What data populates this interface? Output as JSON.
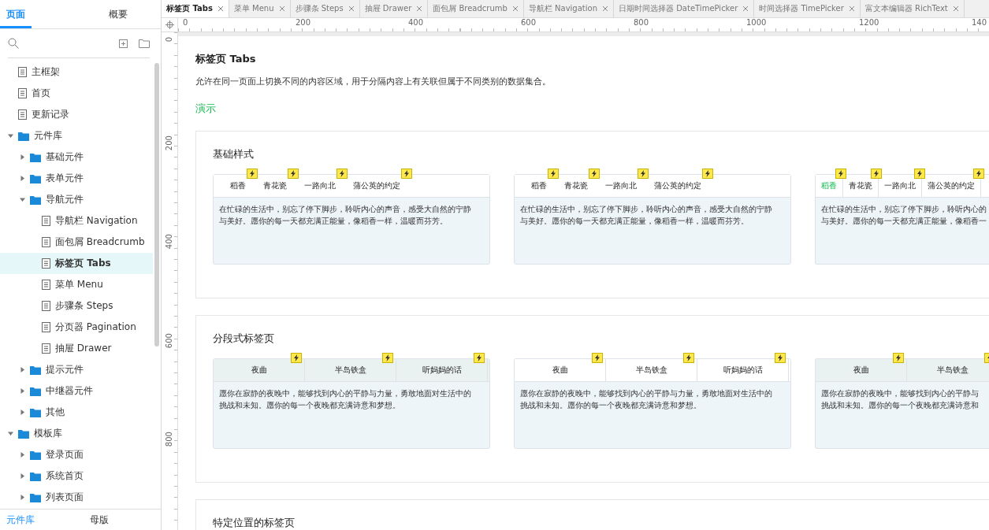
{
  "sidebar": {
    "tabs": [
      {
        "label": "页面",
        "selected": true
      },
      {
        "label": "概要",
        "selected": false
      }
    ],
    "tree": [
      {
        "label": "主框架",
        "kind": "page",
        "selected": false
      },
      {
        "label": "首页",
        "kind": "page",
        "selected": false
      },
      {
        "label": "更新记录",
        "kind": "page",
        "selected": false
      },
      {
        "label": "元件库",
        "kind": "folder",
        "expanded": true,
        "selected": false,
        "children": [
          {
            "label": "基础元件",
            "kind": "folder",
            "expanded": false,
            "selected": false
          },
          {
            "label": "表单元件",
            "kind": "folder",
            "expanded": false,
            "selected": false
          },
          {
            "label": "导航元件",
            "kind": "folder",
            "expanded": true,
            "selected": false,
            "children": [
              {
                "label": "导航栏 Navigation",
                "kind": "page",
                "selected": false
              },
              {
                "label": "面包屑 Breadcrumb",
                "kind": "page",
                "selected": false
              },
              {
                "label": "标签页 Tabs",
                "kind": "page",
                "selected": true
              },
              {
                "label": "菜单 Menu",
                "kind": "page",
                "selected": false
              },
              {
                "label": "步骤条 Steps",
                "kind": "page",
                "selected": false
              },
              {
                "label": "分页器 Pagination",
                "kind": "page",
                "selected": false
              },
              {
                "label": "抽屉 Drawer",
                "kind": "page",
                "selected": false
              }
            ]
          },
          {
            "label": "提示元件",
            "kind": "folder",
            "expanded": false,
            "selected": false
          },
          {
            "label": "中继器元件",
            "kind": "folder",
            "expanded": false,
            "selected": false
          },
          {
            "label": "其他",
            "kind": "folder",
            "expanded": false,
            "selected": false
          }
        ]
      },
      {
        "label": "模板库",
        "kind": "folder",
        "expanded": true,
        "selected": false,
        "children": [
          {
            "label": "登录页面",
            "kind": "folder",
            "expanded": false,
            "selected": false
          },
          {
            "label": "系统首页",
            "kind": "folder",
            "expanded": false,
            "selected": false
          },
          {
            "label": "列表页面",
            "kind": "folder",
            "expanded": false,
            "selected": false
          }
        ]
      }
    ],
    "bottom_tabs": [
      {
        "label": "元件库",
        "selected": true
      },
      {
        "label": "母版",
        "selected": false
      }
    ]
  },
  "doc_tabs": [
    {
      "label": "标签页 Tabs",
      "selected": true
    },
    {
      "label": "菜单 Menu",
      "selected": false
    },
    {
      "label": "步骤条 Steps",
      "selected": false
    },
    {
      "label": "抽屉 Drawer",
      "selected": false
    },
    {
      "label": "面包屑 Breadcrumb",
      "selected": false
    },
    {
      "label": "导航栏 Navigation",
      "selected": false
    },
    {
      "label": "日期时间选择器 DateTimePicker",
      "selected": false
    },
    {
      "label": "时间选择器 TimePicker",
      "selected": false
    },
    {
      "label": "富文本编辑器 RichText",
      "selected": false
    }
  ],
  "ruler": {
    "x_labels": [
      "0",
      "200",
      "400",
      "600",
      "800",
      "1000",
      "1200",
      "140"
    ],
    "y_labels": [
      "0",
      "200",
      "400",
      "600",
      "800"
    ]
  },
  "page": {
    "title": "标签页 Tabs",
    "description": "允许在同一页面上切换不同的内容区域，用于分隔内容上有关联但属于不同类别的数据集合。",
    "demo_link": "演示",
    "sections": [
      {
        "title": "基础样式",
        "kind": "basic",
        "cards": [
          {
            "kind": "plain",
            "tabs": [
              {
                "label": "稻香",
                "selected": false
              },
              {
                "label": "青花瓷",
                "selected": false
              },
              {
                "label": "一路向北",
                "selected": false
              },
              {
                "label": "蒲公英的约定",
                "selected": false
              }
            ],
            "lines": [
              "在忙碌的生活中，别忘了停下脚步，聆听内心的声音，感受大自然的宁静",
              "与美好。愿你的每一天都充满正能量，像稻香一样，温暖而芬芳。"
            ]
          },
          {
            "kind": "plain",
            "tabs": [
              {
                "label": "稻香",
                "selected": false
              },
              {
                "label": "青花瓷",
                "selected": false
              },
              {
                "label": "一路向北",
                "selected": false
              },
              {
                "label": "蒲公英的约定",
                "selected": false
              }
            ],
            "lines": [
              "在忙碌的生活中，别忘了停下脚步，聆听内心的声音，感受大自然的宁静",
              "与美好。愿你的每一天都充满正能量，像稻香一样，温暖而芬芳。"
            ]
          },
          {
            "kind": "boxed",
            "tabs": [
              {
                "label": "稻香",
                "selected": true
              },
              {
                "label": "青花瓷",
                "selected": false
              },
              {
                "label": "一路向北",
                "selected": false
              },
              {
                "label": "蒲公英的约定",
                "selected": false
              }
            ],
            "lines": [
              "在忙碌的生活中，别忘了停下脚步，聆听内心的",
              "与美好。愿你的每一天都充满正能量，像稻香一"
            ]
          }
        ]
      },
      {
        "title": "分段式标签页",
        "kind": "segmented",
        "cards": [
          {
            "kind": "shaded",
            "tabs": [
              {
                "label": "夜曲",
                "selected": false
              },
              {
                "label": "半岛铁盒",
                "selected": false
              },
              {
                "label": "听妈妈的话",
                "selected": false
              }
            ],
            "lines": [
              "愿你在寂静的夜晚中，能够找到内心的平静与力量，勇敢地面对生活中的",
              "挑战和未知。愿你的每一个夜晚都充满诗意和梦想。"
            ]
          },
          {
            "kind": "plain",
            "tabs": [
              {
                "label": "夜曲",
                "selected": false
              },
              {
                "label": "半岛铁盒",
                "selected": false
              },
              {
                "label": "听妈妈的话",
                "selected": false
              }
            ],
            "lines": [
              "愿你在寂静的夜晚中，能够找到内心的平静与力量，勇敢地面对生活中的",
              "挑战和未知。愿你的每一个夜晚都充满诗意和梦想。"
            ]
          },
          {
            "kind": "shaded",
            "tabs": [
              {
                "label": "夜曲",
                "selected": false
              },
              {
                "label": "半岛铁盒",
                "selected": false
              }
            ],
            "lines": [
              "愿你在寂静的夜晚中，能够找到内心的平静与",
              "挑战和未知。愿你的每一个夜晚都充满诗意和"
            ]
          }
        ]
      },
      {
        "title": "特定位置的标签页"
      }
    ]
  }
}
